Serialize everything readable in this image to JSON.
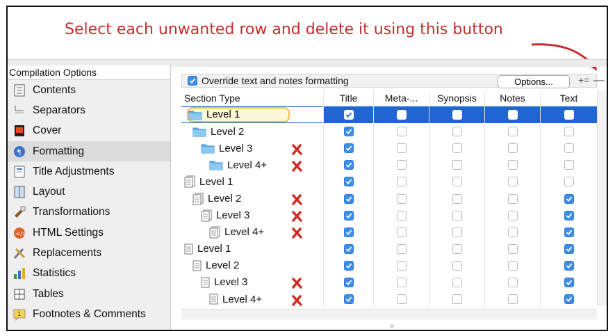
{
  "annotation": "Select each unwanted row and delete it using this button",
  "sidebar": {
    "header": "Compilation Options",
    "items": [
      {
        "label": "Contents",
        "icon": "contents-icon"
      },
      {
        "label": "Separators",
        "icon": "separators-icon"
      },
      {
        "label": "Cover",
        "icon": "cover-icon"
      },
      {
        "label": "Formatting",
        "icon": "formatting-icon",
        "selected": true
      },
      {
        "label": "Title Adjustments",
        "icon": "title-adjustments-icon"
      },
      {
        "label": "Layout",
        "icon": "layout-icon"
      },
      {
        "label": "Transformations",
        "icon": "transformations-icon"
      },
      {
        "label": "HTML Settings",
        "icon": "html-settings-icon"
      },
      {
        "label": "Replacements",
        "icon": "replacements-icon"
      },
      {
        "label": "Statistics",
        "icon": "statistics-icon"
      },
      {
        "label": "Tables",
        "icon": "tables-icon"
      },
      {
        "label": "Footnotes & Comments",
        "icon": "footnotes-comments-icon"
      }
    ]
  },
  "toolbar": {
    "override_label": "Override text and notes formatting",
    "override_checked": true,
    "options_label": "Options...",
    "add_remove_icon": "+=",
    "remove_icon": "—"
  },
  "columns": [
    "Section Type",
    "Title",
    "Meta-...",
    "Synopsis",
    "Notes",
    "Text"
  ],
  "rows": [
    {
      "label": "Level  1",
      "kind": "folder",
      "indent": 0,
      "selected": true,
      "x": false,
      "checks": [
        true,
        false,
        false,
        false,
        false
      ]
    },
    {
      "label": "Level  2",
      "kind": "folder",
      "indent": 1,
      "x": false,
      "checks": [
        true,
        false,
        false,
        false,
        false
      ]
    },
    {
      "label": "Level  3",
      "kind": "folder",
      "indent": 2,
      "x": true,
      "checks": [
        true,
        false,
        false,
        false,
        false
      ]
    },
    {
      "label": "Level  4+",
      "kind": "folder",
      "indent": 3,
      "x": true,
      "checks": [
        true,
        false,
        false,
        false,
        false
      ]
    },
    {
      "label": "Level  1",
      "kind": "doc-stack",
      "indent": 0,
      "x": false,
      "checks": [
        true,
        false,
        false,
        false,
        false
      ]
    },
    {
      "label": "Level  2",
      "kind": "doc-stack",
      "indent": 1,
      "x": true,
      "checks": [
        true,
        false,
        false,
        false,
        true
      ]
    },
    {
      "label": "Level  3",
      "kind": "doc-stack",
      "indent": 2,
      "x": true,
      "checks": [
        true,
        false,
        false,
        false,
        true
      ]
    },
    {
      "label": "Level  4+",
      "kind": "doc-stack",
      "indent": 3,
      "x": true,
      "checks": [
        true,
        false,
        false,
        false,
        true
      ]
    },
    {
      "label": "Level  1",
      "kind": "doc",
      "indent": 0,
      "x": false,
      "checks": [
        true,
        false,
        false,
        false,
        true
      ]
    },
    {
      "label": "Level  2",
      "kind": "doc",
      "indent": 1,
      "x": false,
      "checks": [
        true,
        false,
        false,
        false,
        true
      ]
    },
    {
      "label": "Level  3",
      "kind": "doc",
      "indent": 2,
      "x": true,
      "checks": [
        true,
        false,
        false,
        false,
        true
      ]
    },
    {
      "label": "Level  4+",
      "kind": "doc",
      "indent": 3,
      "x": true,
      "checks": [
        true,
        false,
        false,
        false,
        true
      ]
    }
  ],
  "colors": {
    "accent": "#1f66d3",
    "checkbox": "#3d8ee8",
    "annotation": "#c62d2d",
    "delete_mark": "#d42a1f"
  }
}
